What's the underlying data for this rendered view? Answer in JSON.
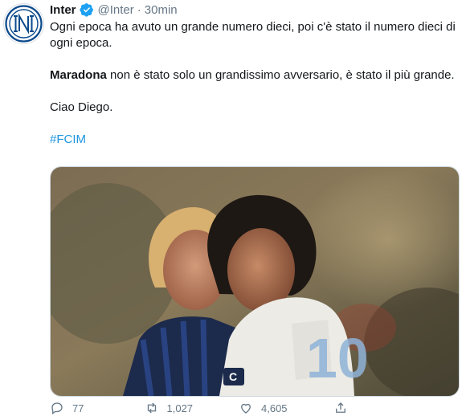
{
  "tweet": {
    "name": "Inter",
    "handle": "@Inter",
    "separator": "·",
    "time": "30min",
    "line1": "Ogni epoca ha avuto un grande numero dieci, poi c'è stato il numero dieci di ogni epoca.",
    "line2_bold": "Maradona",
    "line2_rest": " non è stato solo un grandissimo avversario, è stato il più grande.",
    "line3": "Ciao Diego.",
    "hashtag": "#FCIM"
  },
  "actions": {
    "reply_count": "77",
    "retweet_count": "1,027",
    "like_count": "4,605"
  },
  "icons": {
    "avatar": "inter-logo-icon",
    "verified": "verified-badge-icon",
    "reply": "reply-icon",
    "retweet": "retweet-icon",
    "like": "heart-icon",
    "share": "share-icon"
  },
  "colors": {
    "accent": "#1da1f2",
    "hashtag": "#1b95e0",
    "muted": "#657786",
    "text": "#14171a"
  }
}
